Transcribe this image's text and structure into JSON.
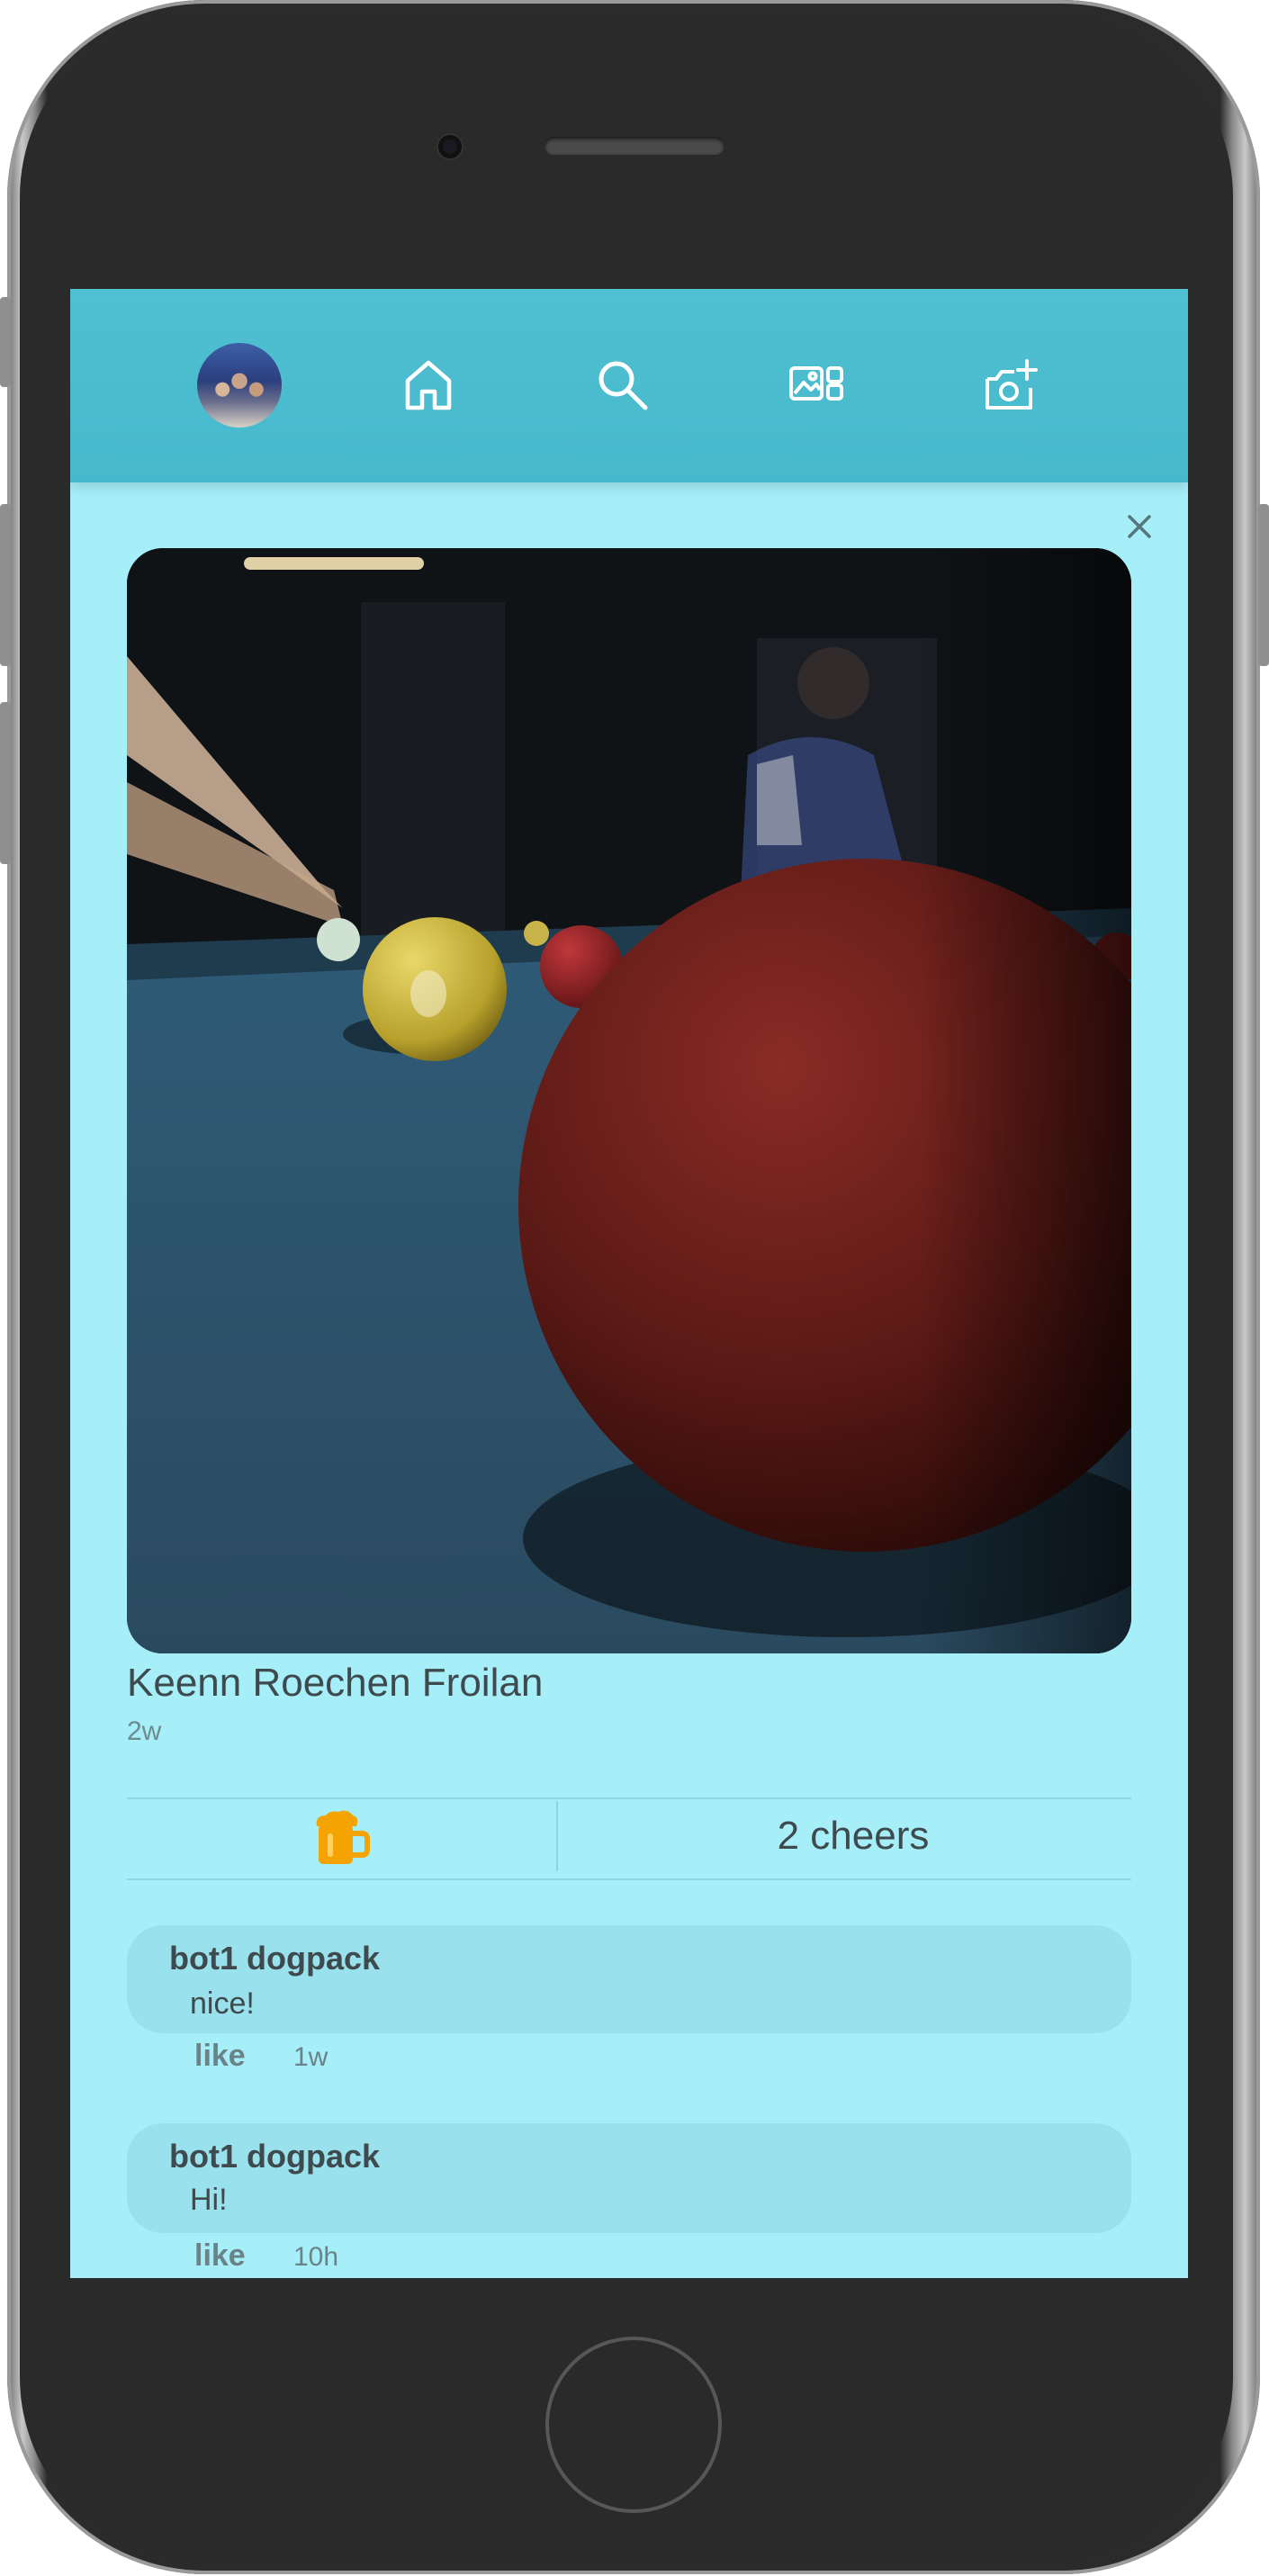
{
  "nav": {
    "avatar": "profile-avatar",
    "icons": [
      "home-icon",
      "search-icon",
      "gallery-icon",
      "add-photo-icon"
    ]
  },
  "post": {
    "author": "Keenn Roechen Froilan",
    "time": "2w",
    "cheer_icon": "beer-mug-icon",
    "cheers": "2 cheers"
  },
  "comments": [
    {
      "author": "bot1 dogpack",
      "text": "nice!",
      "like": "like",
      "time": "1w"
    },
    {
      "author": "bot1 dogpack",
      "text": "Hi!",
      "like": "like",
      "time": "10h"
    }
  ],
  "colors": {
    "navbar": "#4fc0d1",
    "screen_bg": "#a6eef8",
    "comment_bubble": "#99e1ec",
    "accent_cheer": "#f5a300"
  }
}
